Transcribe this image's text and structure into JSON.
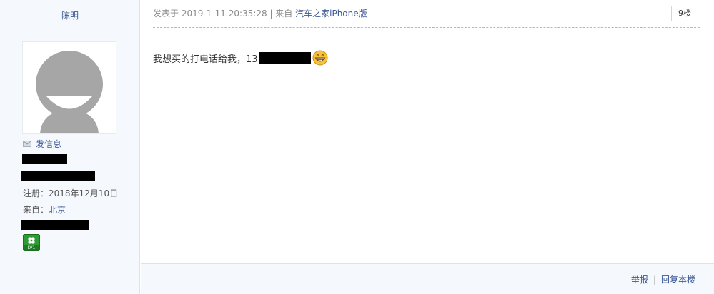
{
  "user": {
    "name": "陈明",
    "send_message_label": "发信息",
    "register_label": "注册：",
    "register_date": "2018年12月10日",
    "from_label": "来自：",
    "from_value": "北京",
    "level_badge": "LV1"
  },
  "post": {
    "meta_prefix": "发表于 2019-1-11 20:35:28 | 来自 ",
    "source": "汽车之家iPhone版",
    "floor": "9楼",
    "content_text": "我想买的打电话给我，13",
    "emoji": "grinning-emoji"
  },
  "footer": {
    "report_label": "举报",
    "separator": "|",
    "reply_label": "回复本楼"
  },
  "colors": {
    "link": "#3b5998",
    "sidebar_bg": "#f5f8fc",
    "badge_green": "#2e9b33"
  }
}
